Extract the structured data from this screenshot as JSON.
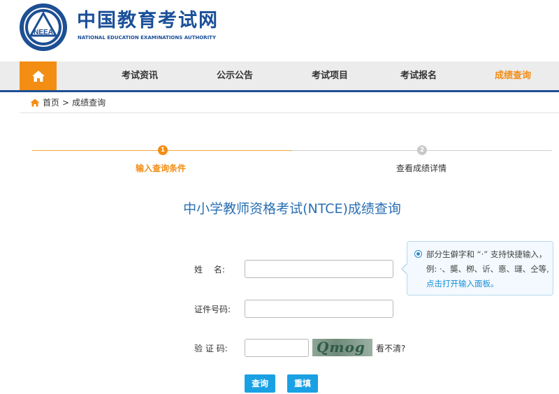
{
  "header": {
    "site_name_cn": "中国教育考试网",
    "site_name_en": "NATIONAL EDUCATION EXAMINATIONS AUTHORITY",
    "logo_text": "NEEA"
  },
  "nav": {
    "home_icon": "home-icon",
    "items": [
      "考试资讯",
      "公示公告",
      "考试项目",
      "考试报名",
      "成绩查询"
    ],
    "active_index": 4,
    "accent_color": "#f38d13",
    "brand_color": "#1d4f93"
  },
  "breadcrumb": {
    "home": "首页",
    "separator": ">",
    "current": "成绩查询"
  },
  "steps": [
    {
      "number": "1",
      "label": "输入查询条件",
      "active": true
    },
    {
      "number": "2",
      "label": "查看成绩详情",
      "active": false
    }
  ],
  "title": "中小学教师资格考试(NTCE)成绩查询",
  "form": {
    "name_label": "姓　 名:",
    "id_label": "证件号码:",
    "captcha_label": "验 证 码:",
    "captcha_text": "Qmog",
    "unclear": "看不清?",
    "name_value": "",
    "id_value": "",
    "captcha_value": ""
  },
  "tip": {
    "text": "部分生僻字和 “·” 支持快捷输入，例: ·、龑、栁、䜣、㥁、璭、仝等,",
    "link": "点击打开输入面板。"
  },
  "buttons": {
    "query": "查询",
    "reset": "重填"
  }
}
